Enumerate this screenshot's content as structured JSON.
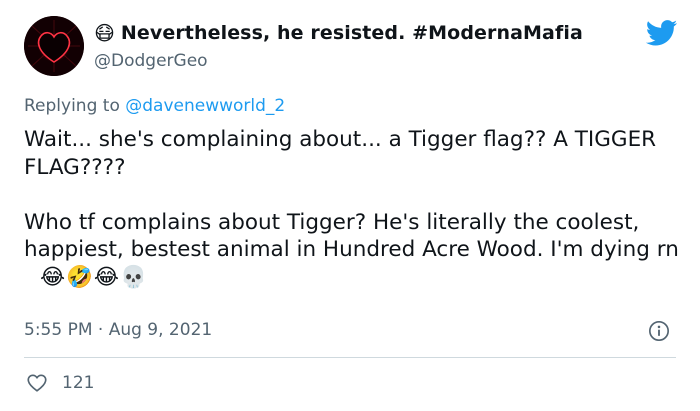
{
  "tweet": {
    "name_emoji": "😷",
    "display_name": "Nevertheless, he resisted. #ModernaMafia",
    "handle": "@DodgerGeo",
    "replying_prefix": "Replying to ",
    "replying_to": "@davenewworld_2",
    "body_paragraph_1": "Wait... she's complaining about... a Tigger flag?? A TIGGER FLAG????",
    "body_paragraph_2": "Who tf complains about Tigger? He's literally the coolest, happiest, bestest animal in Hundred Acre Wood. I'm dying rn",
    "body_emojis": "😂🤣😂💀",
    "timestamp": "5:55 PM · Aug 9, 2021",
    "like_count": "121"
  },
  "icons": {
    "avatar": "heart-avatar",
    "brand": "twitter-bird-icon",
    "info": "info-icon",
    "like": "heart-outline-icon"
  },
  "colors": {
    "accent": "#1d9bf0",
    "text_primary": "#0f1419",
    "text_secondary": "#536471",
    "divider": "#cfd9de"
  }
}
